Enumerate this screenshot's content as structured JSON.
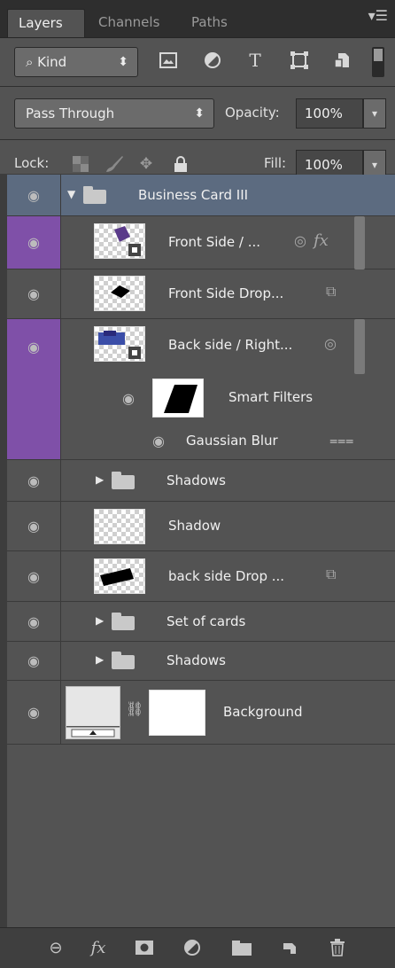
{
  "tabs": [
    {
      "label": "Layers",
      "active": true
    },
    {
      "label": "Channels",
      "active": false
    },
    {
      "label": "Paths",
      "active": false
    }
  ],
  "filter": {
    "kind_label": "⌕ Kind",
    "kind_arrow": "⬍",
    "icons": [
      "image-filter-icon",
      "adjustment-filter-icon",
      "type-filter-icon",
      "shape-filter-icon",
      "smart-object-filter-icon"
    ]
  },
  "blend": {
    "mode": "Pass Through",
    "mode_arrow": "⬍",
    "opacity_label": "Opacity:",
    "opacity_value": "100%"
  },
  "lock": {
    "label": "Lock:",
    "fill_label": "Fill:",
    "fill_value": "100%"
  },
  "layers": [
    {
      "id": "business-card-iii",
      "name": "Business Card III",
      "type": "group",
      "expanded": true,
      "selected": true
    },
    {
      "id": "front-side",
      "name": "Front Side / ...",
      "type": "smart",
      "badges": [
        "◎",
        "fx"
      ],
      "purple_eye": true
    },
    {
      "id": "front-side-drop",
      "name": "Front Side Drop...",
      "type": "smart-linked"
    },
    {
      "id": "back-side-right",
      "name": "Back side / Right...",
      "type": "smart",
      "badges": [
        "◎"
      ],
      "purple_eye": true
    },
    {
      "id": "smart-filters",
      "name": "Smart Filters",
      "type": "filter-mask"
    },
    {
      "id": "gaussian-blur",
      "name": "Gaussian Blur",
      "type": "filter"
    },
    {
      "id": "shadows-1",
      "name": "Shadows",
      "type": "group",
      "expanded": false
    },
    {
      "id": "shadow",
      "name": "Shadow",
      "type": "pixel"
    },
    {
      "id": "back-side-drop",
      "name": "back side Drop ...",
      "type": "smart-linked"
    },
    {
      "id": "set-of-cards",
      "name": "Set of cards",
      "type": "group",
      "expanded": false
    },
    {
      "id": "shadows-2",
      "name": "Shadows",
      "type": "group",
      "expanded": false
    },
    {
      "id": "background",
      "name": "Background",
      "type": "background"
    }
  ],
  "bottom_icons": [
    "link-layers-icon",
    "fx-icon",
    "add-mask-icon",
    "adjustment-layer-icon",
    "new-group-icon",
    "new-layer-icon",
    "delete-layer-icon"
  ]
}
